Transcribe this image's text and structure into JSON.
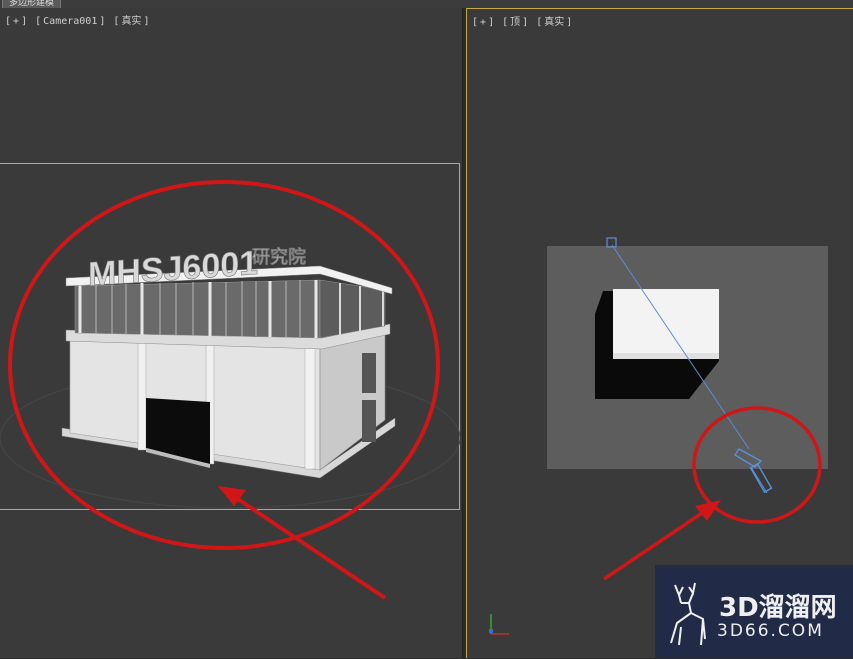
{
  "top_tab": {
    "label": "多边形建模"
  },
  "left_viewport": {
    "label_parts": [
      "[",
      "+",
      "]",
      "[",
      "Camera001",
      "]",
      "[",
      "真实",
      "]"
    ]
  },
  "right_viewport": {
    "label_parts": [
      "[",
      "+",
      "]",
      "[",
      "顶",
      "]",
      "[",
      "真实",
      "]"
    ]
  },
  "building_sign": {
    "letters": "MHSJ6001",
    "suffix": "研究院"
  },
  "watermark": {
    "brand": "3D溜溜网",
    "url": "3D66.COM"
  },
  "colors": {
    "viewport_bg": "#3a3a3a",
    "active_border": "#c8a64a",
    "safe_frame": "#b8b44a",
    "annotation_red": "#d01616",
    "camera_blue": "#5b8fd6"
  }
}
